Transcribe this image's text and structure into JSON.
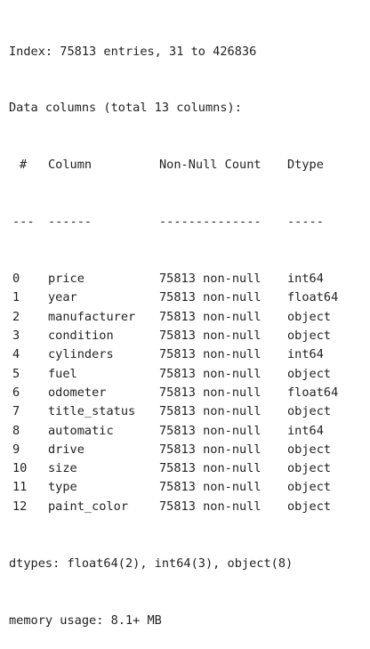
{
  "output": {
    "index_line": "Index: 75813 entries, 31 to 426836",
    "data_columns_line": "Data columns (total 13 columns):",
    "header": {
      "idx": "#",
      "column": "Column",
      "non_null": "Non-Null Count",
      "dtype": "Dtype"
    },
    "separator": {
      "idx": "---",
      "column": "------",
      "non_null": "--------------",
      "dtype": "-----"
    },
    "rows": [
      {
        "idx": "0",
        "column": "price",
        "non_null": "75813 non-null",
        "dtype": "int64"
      },
      {
        "idx": "1",
        "column": "year",
        "non_null": "75813 non-null",
        "dtype": "float64"
      },
      {
        "idx": "2",
        "column": "manufacturer",
        "non_null": "75813 non-null",
        "dtype": "object"
      },
      {
        "idx": "3",
        "column": "condition",
        "non_null": "75813 non-null",
        "dtype": "object"
      },
      {
        "idx": "4",
        "column": "cylinders",
        "non_null": "75813 non-null",
        "dtype": "int64"
      },
      {
        "idx": "5",
        "column": "fuel",
        "non_null": "75813 non-null",
        "dtype": "object"
      },
      {
        "idx": "6",
        "column": "odometer",
        "non_null": "75813 non-null",
        "dtype": "float64"
      },
      {
        "idx": "7",
        "column": "title_status",
        "non_null": "75813 non-null",
        "dtype": "object"
      },
      {
        "idx": "8",
        "column": "automatic",
        "non_null": "75813 non-null",
        "dtype": "int64"
      },
      {
        "idx": "9",
        "column": "drive",
        "non_null": "75813 non-null",
        "dtype": "object"
      },
      {
        "idx": "10",
        "column": "size",
        "non_null": "75813 non-null",
        "dtype": "object"
      },
      {
        "idx": "11",
        "column": "type",
        "non_null": "75813 non-null",
        "dtype": "object"
      },
      {
        "idx": "12",
        "column": "paint_color",
        "non_null": "75813 non-null",
        "dtype": "object"
      }
    ],
    "dtypes_line": "dtypes: float64(2), int64(3), object(8)",
    "memory_line": "memory usage: 8.1+ MB"
  }
}
